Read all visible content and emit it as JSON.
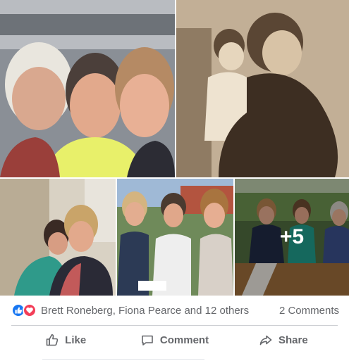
{
  "post": {
    "more_photos": "+5",
    "reactions": {
      "icons": [
        "like-reaction-icon",
        "love-reaction-icon"
      ],
      "colors": {
        "like": "#1877f2",
        "love": "#f33e58"
      },
      "names": "Brett Roneberg, Fiona Pearce and 12 others",
      "comments": "2 Comments"
    },
    "actions": {
      "like": "Like",
      "comment": "Comment",
      "share": "Share"
    }
  }
}
